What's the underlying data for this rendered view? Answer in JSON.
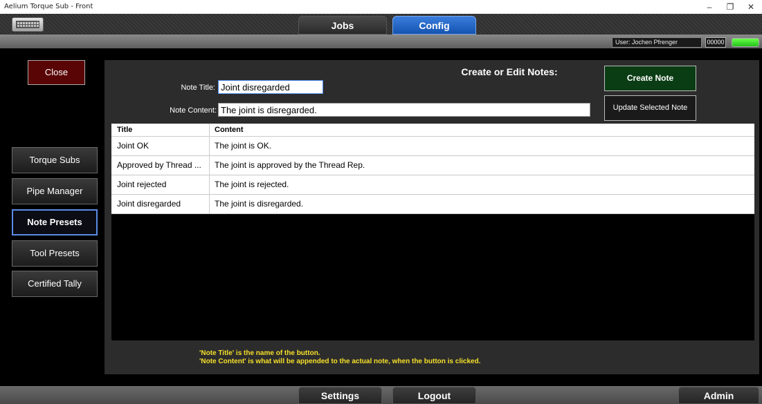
{
  "window": {
    "title": "Aelium Torque Sub - Front",
    "controls": {
      "minimize": "–",
      "restore": "❐",
      "close": "✕"
    }
  },
  "topbar": {
    "keyboard_icon": "keyboard-icon",
    "tabs": [
      {
        "label": "Jobs",
        "active": false
      },
      {
        "label": "Config",
        "active": true
      }
    ]
  },
  "status": {
    "user": "User: Jochen Pfrenger",
    "counter": "00000",
    "indicator_color": "#3ee02a"
  },
  "sidebar": {
    "close_label": "Close",
    "items": [
      {
        "label": "Torque Subs",
        "active": false
      },
      {
        "label": "Pipe Manager",
        "active": false
      },
      {
        "label": "Note Presets",
        "active": true
      },
      {
        "label": "Tool Presets",
        "active": false
      },
      {
        "label": "Certified Tally",
        "active": false
      }
    ]
  },
  "editor": {
    "heading": "Create or Edit Notes:",
    "title_label": "Note Title:",
    "title_value": "Joint disregarded",
    "content_label": "Note Content:",
    "content_value": "The joint is disregarded.",
    "create_button": "Create Note",
    "update_button": "Update Selected Note"
  },
  "table": {
    "columns": [
      "Title",
      "Content"
    ],
    "rows": [
      {
        "title": "Joint OK",
        "content": "The joint is OK."
      },
      {
        "title": "Approved by Thread ...",
        "content": "The joint is approved by the Thread Rep."
      },
      {
        "title": "Joint rejected",
        "content": "The joint is rejected."
      },
      {
        "title": "Joint disregarded",
        "content": "The joint is disregarded."
      }
    ]
  },
  "help": {
    "line1": "'Note Title' is the name of the button.",
    "line2": "'Note Content' is what will be appended to the actual note, when the button is clicked."
  },
  "bottombar": {
    "settings": "Settings",
    "logout": "Logout",
    "admin": "Admin"
  },
  "colors": {
    "accent": "#1e63c8",
    "close_button": "#5a0505",
    "create_button": "#0b3d14",
    "help_text": "#f5e02a"
  }
}
